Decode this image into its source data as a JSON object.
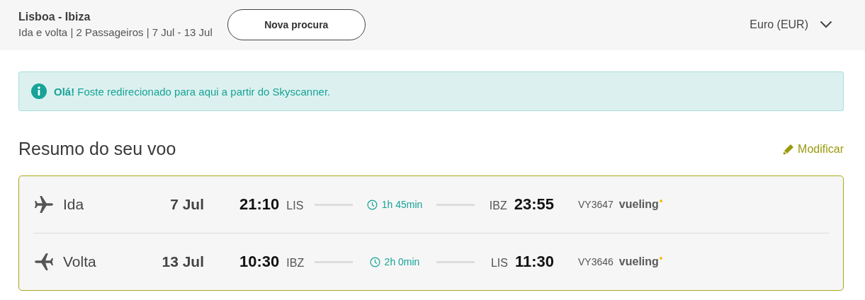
{
  "header": {
    "route": "Lisboa - Ibiza",
    "details": "Ida e volta | 2 Passageiros | 7 Jul - 13 Jul",
    "new_search_button": "Nova procura",
    "currency": "Euro (EUR)"
  },
  "alert": {
    "text": "**Olá!** Foste redirecionado para aqui a partir do Skyscanner."
  },
  "summary": {
    "title": "Resumo do seu voo",
    "modify_link": "Modificar"
  },
  "flights": [
    {
      "kind": "outbound",
      "label": "Ida",
      "date": "7 Jul",
      "departure_time": "21:10",
      "origin": "LIS",
      "duration": "1h 45min",
      "destination": "IBZ",
      "arrival_time": "23:55",
      "flight_number": "VY3647",
      "airline": "vueling"
    },
    {
      "kind": "return",
      "label": "Volta",
      "date": "13 Jul",
      "departure_time": "10:30",
      "origin": "IBZ",
      "duration": "2h 0min",
      "destination": "LIS",
      "arrival_time": "11:30",
      "flight_number": "VY3646",
      "airline": "vueling"
    }
  ]
}
